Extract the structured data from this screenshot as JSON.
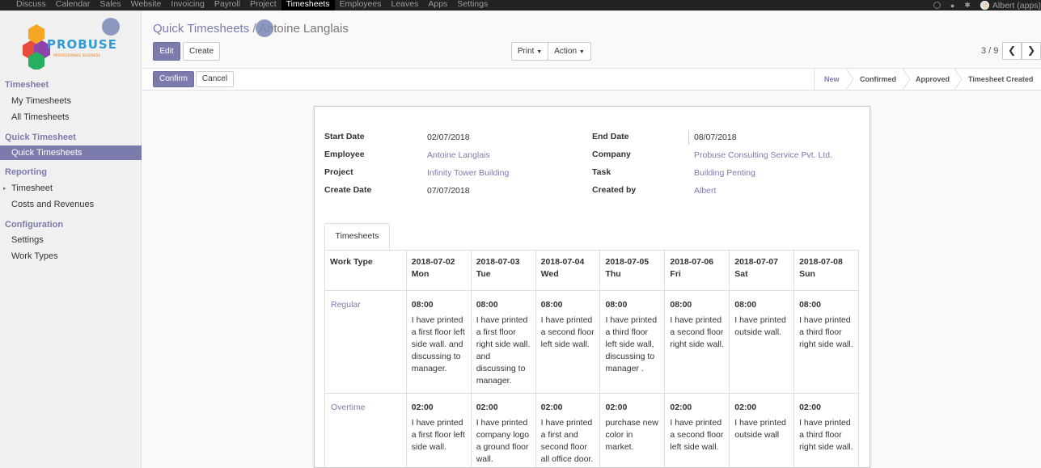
{
  "topbar": {
    "menu": [
      "Discuss",
      "Calendar",
      "Sales",
      "Website",
      "Invoicing",
      "Payroll",
      "Project",
      "Timesheets",
      "Employees",
      "Leaves",
      "Apps",
      "Settings"
    ],
    "active_index": 7,
    "user": "Albert (apps)"
  },
  "sidebar": {
    "logo_text": "PROBUSE",
    "logo_sub": "PROFESSIONAL BUSINESS",
    "sections": [
      {
        "title": "Timesheet",
        "items": [
          "My Timesheets",
          "All Timesheets"
        ]
      },
      {
        "title": "Quick Timesheet",
        "items": [
          "Quick Timesheets"
        ]
      },
      {
        "title": "Reporting",
        "items": [
          "Timesheet",
          "Costs and Revenues"
        ]
      },
      {
        "title": "Configuration",
        "items": [
          "Settings",
          "Work Types"
        ]
      }
    ]
  },
  "breadcrumb": {
    "parent": "Quick Timesheets",
    "separator": "/",
    "current": "Antoine Langlais"
  },
  "buttons": {
    "edit": "Edit",
    "create": "Create",
    "print": "Print",
    "action": "Action",
    "confirm": "Confirm",
    "cancel": "Cancel"
  },
  "pager": {
    "text": "3 / 9"
  },
  "statusbar": {
    "stages": [
      "New",
      "Confirmed",
      "Approved",
      "Timesheet Created"
    ],
    "current": "New"
  },
  "form": {
    "start_date_label": "Start Date",
    "start_date": "02/07/2018",
    "end_date_label": "End Date",
    "end_date": "08/07/2018",
    "employee_label": "Employee",
    "employee": "Antoine Langlais",
    "company_label": "Company",
    "company": "Probuse Consulting Service Pvt. Ltd.",
    "project_label": "Project",
    "project": "Infinity Tower Building",
    "task_label": "Task",
    "task": "Building Penting",
    "create_date_label": "Create Date",
    "create_date": "07/07/2018",
    "created_by_label": "Created by",
    "created_by": "Albert"
  },
  "tab": {
    "label": "Timesheets"
  },
  "grid": {
    "work_type_header": "Work Type",
    "days": [
      {
        "date": "2018-07-02",
        "day": "Mon"
      },
      {
        "date": "2018-07-03",
        "day": "Tue"
      },
      {
        "date": "2018-07-04",
        "day": "Wed"
      },
      {
        "date": "2018-07-05",
        "day": "Thu"
      },
      {
        "date": "2018-07-06",
        "day": "Fri"
      },
      {
        "date": "2018-07-07",
        "day": "Sat"
      },
      {
        "date": "2018-07-08",
        "day": "Sun"
      }
    ],
    "rows": [
      {
        "type": "Regular",
        "cells": [
          {
            "hours": "08:00",
            "desc": "I have printed a first floor left side wall. and discussing to manager."
          },
          {
            "hours": "08:00",
            "desc": "I have printed a first floor right side wall. and discussing to manager."
          },
          {
            "hours": "08:00",
            "desc": "I have printed a second floor left side wall."
          },
          {
            "hours": "08:00",
            "desc": "I have printed a third floor left side wall, discussing to manager ."
          },
          {
            "hours": "08:00",
            "desc": "I have printed a second floor right side wall."
          },
          {
            "hours": "08:00",
            "desc": "I have printed outside wall."
          },
          {
            "hours": "08:00",
            "desc": "I have printed a third floor right side wall."
          }
        ]
      },
      {
        "type": "Overtime",
        "cells": [
          {
            "hours": "02:00",
            "desc": "I have printed a first floor left side wall."
          },
          {
            "hours": "02:00",
            "desc": "I have printed company logo a ground floor wall."
          },
          {
            "hours": "02:00",
            "desc": "I have printed a first and second floor all office door."
          },
          {
            "hours": "02:00",
            "desc": "purchase new color in market."
          },
          {
            "hours": "02:00",
            "desc": "I have printed a second floor left side wall."
          },
          {
            "hours": "02:00",
            "desc": "I have printed outside wall"
          },
          {
            "hours": "02:00",
            "desc": "I have printed a third floor right side wall."
          }
        ]
      }
    ]
  },
  "colors": {
    "accent": "#7c7bad",
    "topbar": "#222222"
  }
}
